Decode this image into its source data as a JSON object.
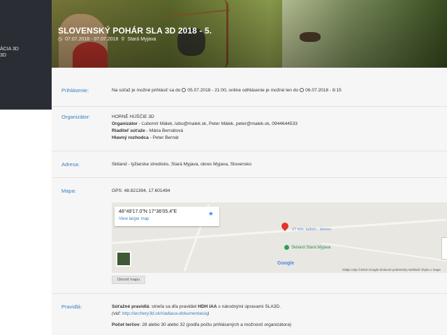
{
  "sidebar": {
    "text_line1": "ÁCIA 3D",
    "text_line2": "3D"
  },
  "hero": {
    "title": "SLOVENSKÝ POHÁR SLA 3D 2018 - 5.",
    "dates": "07.07.2018 - 07.07.2018",
    "location": "Stará Myjava"
  },
  "prihlasenie": {
    "label": "Prihlásenie:",
    "text1": "Na súťaž je možné prihlásiť sa do",
    "date1": "05.07.2018 - 21:00, online odhlásenie je možné len do",
    "date2": "06.07.2018 - 8:15"
  },
  "organizator": {
    "label": "Organizátor:",
    "club": "HORNÉ HÚŠČIE 3D",
    "org_label": "Organizátor",
    "org_value": " - Ľubomír Málek, lubo@malek.sk, Peter Málek, peter@malek.sk, 0944644533",
    "director_label": "Riaditeľ súťaže",
    "director_value": " - Mária Bernátová",
    "judge_label": "Hlavný rozhodca",
    "judge_value": " - Peter Bernát"
  },
  "adresa": {
    "label": "Adresa:",
    "value": "Skiland - lyžiarske stredisko, Stará Myjava, okres Myjava, Slovensko"
  },
  "mapa": {
    "label": "Mapa:",
    "gps": "GPS: 48.821394, 17.601494",
    "coord": "48°49'17.0\"N 17°36'05.4\"E",
    "larger": "View larger map",
    "pin_label": "17 min. autom - domov",
    "poi_label": "Skiland Stará Myjava",
    "google": "Google",
    "footer": "Údaje máp ©2018 Google    Zmluvné podmienky    Nahlásiť chybu v mape",
    "open_button": "Otvoriť mapu"
  },
  "pravidla": {
    "label": "Pravidlá:",
    "rules_bold": "Súťažné pravidlá",
    "rules_text": ": strieľa sa dľa pravidiel ",
    "hdh": "HDH IAA",
    "rules_text2": " s národnými úpravami SLA3D.",
    "see": "(viď: ",
    "link": "http://archery3d.sk/riadiaca-dokumentacia",
    "see_end": ")",
    "targets_bold": "Počet terčov",
    "targets_text": ": 28 alebo 30 alebo 32  (podľa počtu prihlásených a možností organizátora)"
  }
}
